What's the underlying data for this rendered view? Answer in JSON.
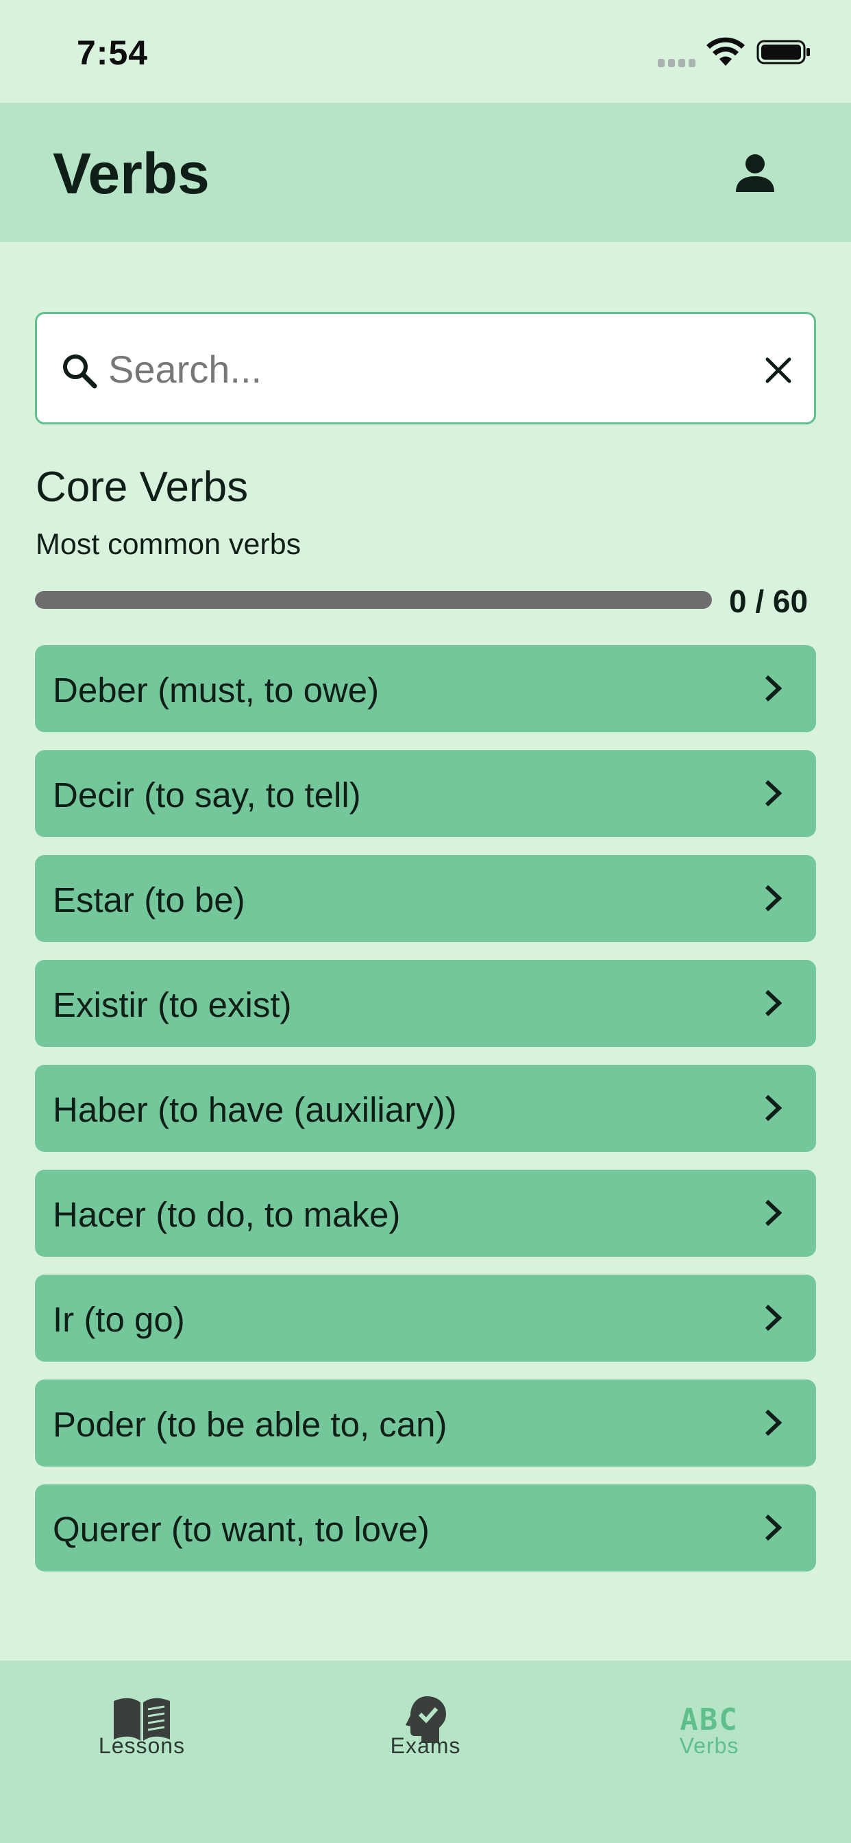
{
  "status_bar": {
    "time": "7:54"
  },
  "header": {
    "title": "Verbs"
  },
  "search": {
    "placeholder": "Search...",
    "value": ""
  },
  "section": {
    "title": "Core Verbs",
    "subtitle": "Most common verbs",
    "progress_text": "0 / 60",
    "progress_fraction": 0
  },
  "verbs": [
    {
      "label": "Deber (must, to owe)"
    },
    {
      "label": "Decir (to say, to tell)"
    },
    {
      "label": "Estar (to be)"
    },
    {
      "label": "Existir (to exist)"
    },
    {
      "label": "Haber (to have (auxiliary))"
    },
    {
      "label": "Hacer (to do, to make)"
    },
    {
      "label": "Ir (to go)"
    },
    {
      "label": "Poder (to be able to, can)"
    },
    {
      "label": "Querer (to want, to love)"
    }
  ],
  "tabs": [
    {
      "label": "Lessons",
      "icon": "book-icon",
      "active": false
    },
    {
      "label": "Exams",
      "icon": "head-check-icon",
      "active": false
    },
    {
      "label": "Verbs",
      "icon": "abc-icon",
      "icon_text": "ABC",
      "active": true
    }
  ],
  "colors": {
    "background": "#d8f2dd",
    "header": "#b6e4c7",
    "list_item": "#74c79b",
    "accent": "#5fbf8c"
  }
}
